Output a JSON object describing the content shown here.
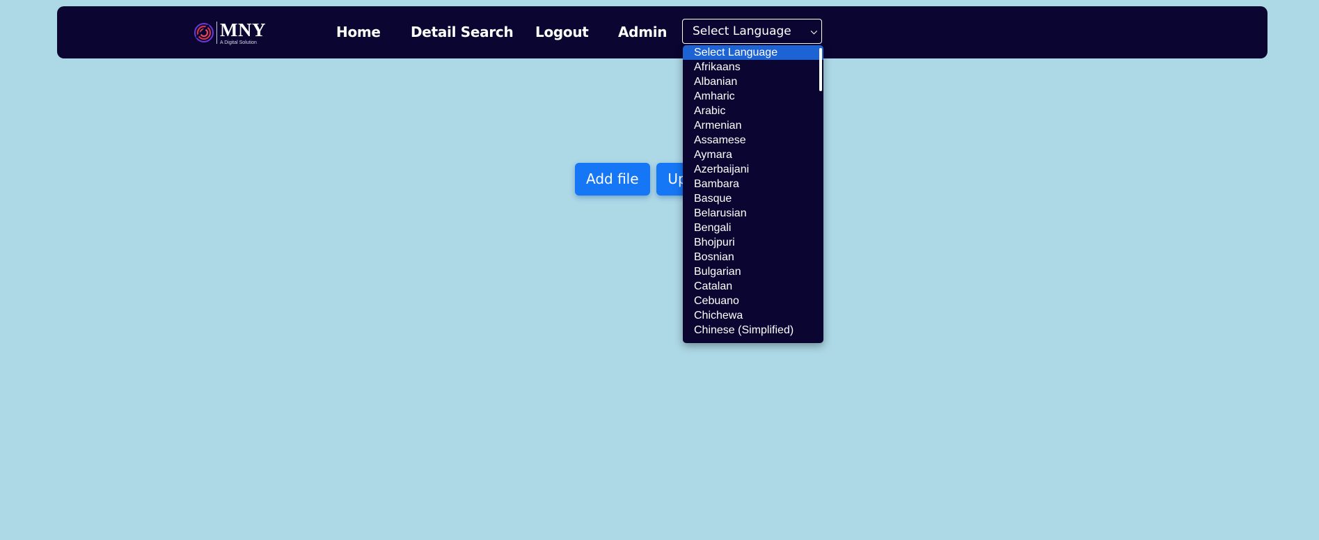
{
  "logo": {
    "title": "MNY",
    "subtitle": "A Digital Solution"
  },
  "nav": {
    "home": "Home",
    "detail_search": "Detail Search",
    "logout": "Logout",
    "admin": "Admin"
  },
  "language_select": {
    "selected": "Select Language",
    "options": [
      "Select Language",
      "Afrikaans",
      "Albanian",
      "Amharic",
      "Arabic",
      "Armenian",
      "Assamese",
      "Aymara",
      "Azerbaijani",
      "Bambara",
      "Basque",
      "Belarusian",
      "Bengali",
      "Bhojpuri",
      "Bosnian",
      "Bulgarian",
      "Catalan",
      "Cebuano",
      "Chichewa",
      "Chinese (Simplified)"
    ]
  },
  "actions": {
    "add_file": "Add file",
    "upload": "Up"
  },
  "colors": {
    "background": "#add8e6",
    "navbar": "#0a0531",
    "primary_button": "#1677f6",
    "dropdown_highlight": "#1e63d3"
  }
}
